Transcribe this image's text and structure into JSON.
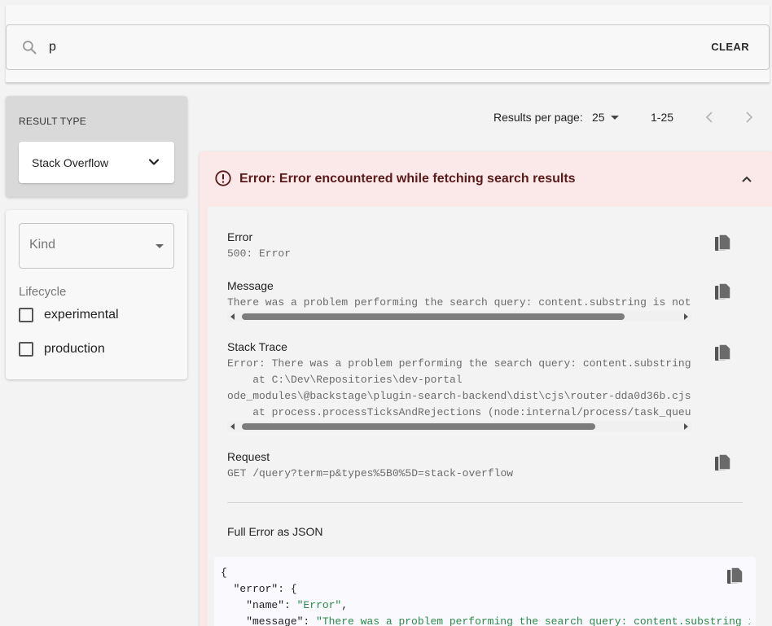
{
  "search": {
    "query": "p",
    "clear_label": "CLEAR"
  },
  "result_type": {
    "label": "RESULT TYPE",
    "selected": "Stack Overflow"
  },
  "filters": {
    "kind_label": "Kind",
    "lifecycle_label": "Lifecycle",
    "options": [
      {
        "label": "experimental",
        "checked": false
      },
      {
        "label": "production",
        "checked": false
      }
    ]
  },
  "pagination": {
    "per_page_label": "Results per page:",
    "per_page_value": "25",
    "range": "1-25"
  },
  "error": {
    "title": "Error: Error encountered while fetching search results",
    "fields": [
      {
        "label": "Error",
        "lines": [
          "500: Error"
        ]
      },
      {
        "label": "Message",
        "lines": [
          "There was a problem performing the search query: content.substring is not"
        ]
      },
      {
        "label": "Stack Trace",
        "lines": [
          "Error: There was a problem performing the search query: content.substring",
          "    at C:\\Dev\\Repositories\\dev-portal",
          "ode_modules\\@backstage\\plugin-search-backend\\dist\\cjs\\router-dda0d36b.cjs.",
          "    at process.processTicksAndRejections (node:internal/process/task_queue"
        ]
      },
      {
        "label": "Request",
        "lines": [
          "GET /query?term=p&types%5B0%5D=stack-overflow"
        ]
      }
    ],
    "json_label": "Full Error as JSON",
    "json_lines": {
      "l1": "{",
      "l2_key": "  \"error\": {",
      "l3_key": "    \"name\": ",
      "l3_val": "\"Error\"",
      "l3_end": ",",
      "l4_key": "    \"message\": ",
      "l4_val": "\"There was a problem performing the search query: content.substring is"
    }
  },
  "colors": {
    "error_background": "#fbe9e9",
    "error_title": "#5a1a1a",
    "json_string": "#2a8a4a"
  }
}
